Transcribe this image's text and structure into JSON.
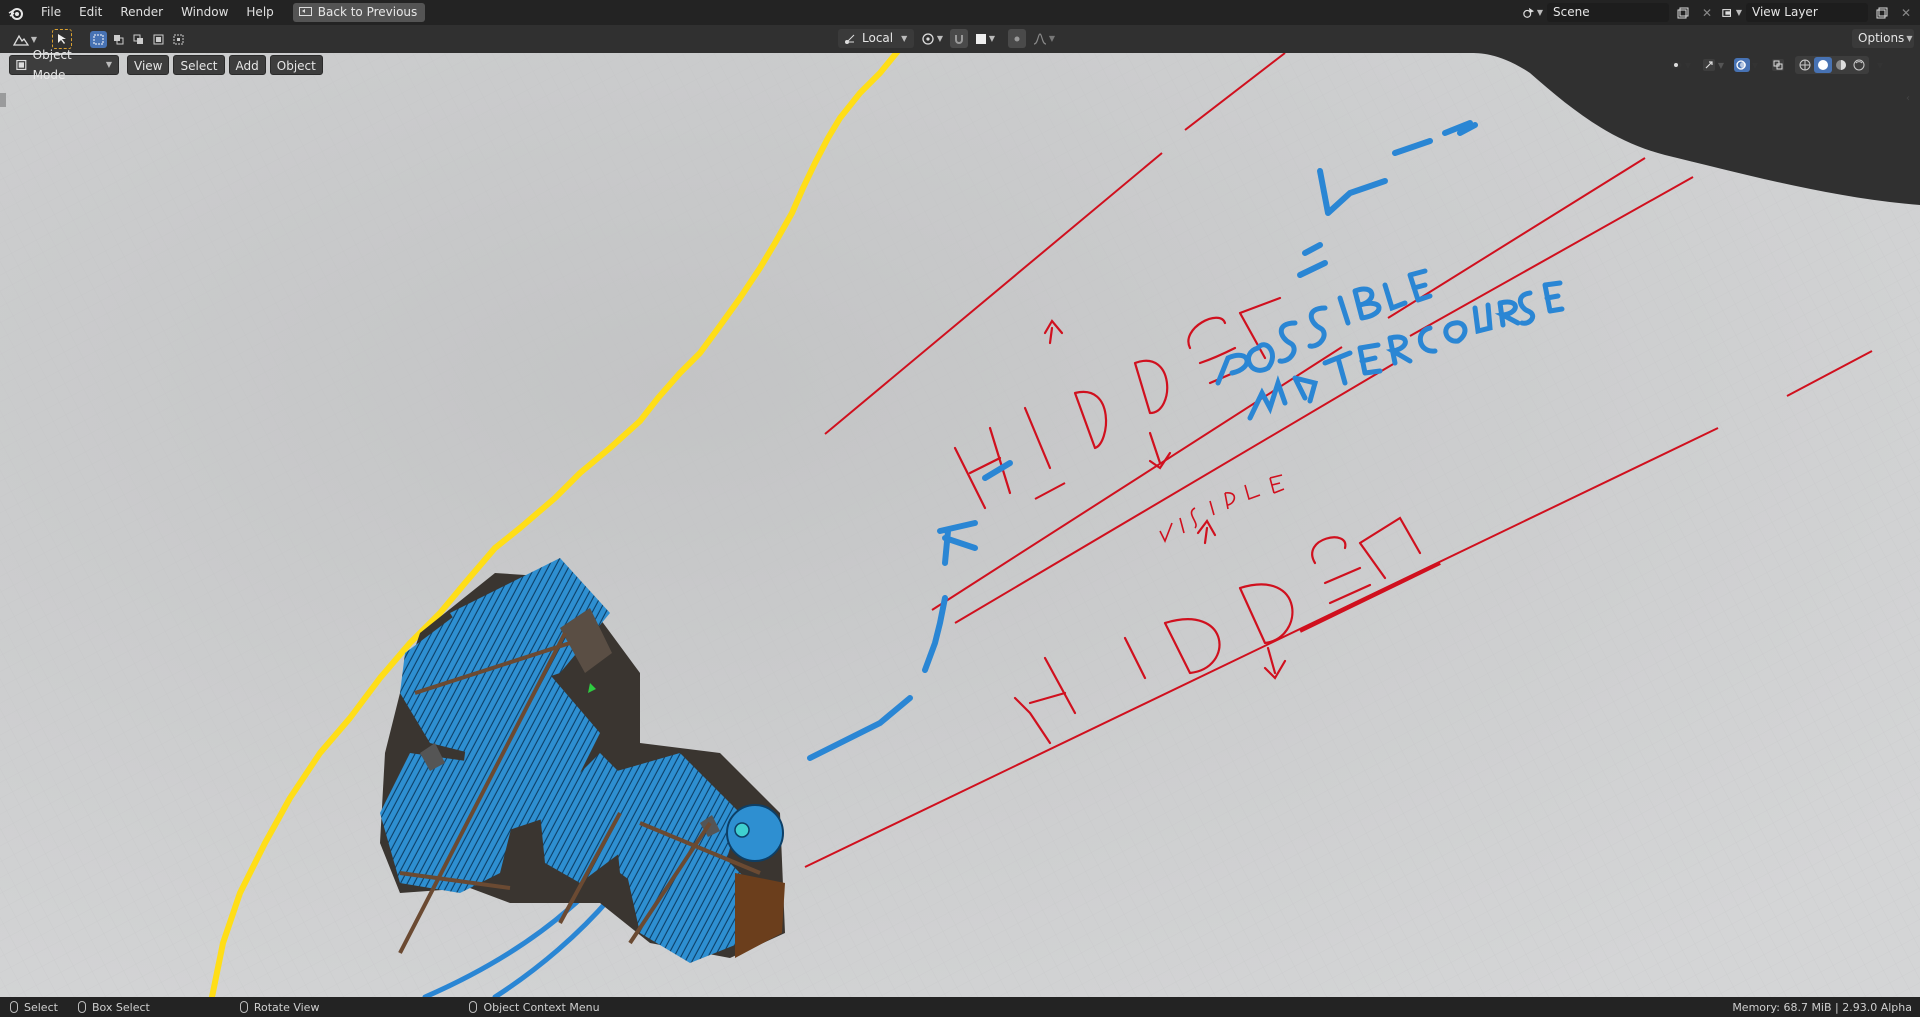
{
  "topbar": {
    "menu": [
      "File",
      "Edit",
      "Render",
      "Window",
      "Help"
    ],
    "back_button": "Back to Previous",
    "scene_name": "Scene",
    "view_layer_name": "View Layer"
  },
  "toolheader": {
    "transform_orientation": "Local",
    "options_label": "Options"
  },
  "viewport_header": {
    "mode": "Object Mode",
    "menus": [
      "View",
      "Select",
      "Add",
      "Object"
    ]
  },
  "annotations": {
    "hidden_top": "HIDDEN",
    "possible_watercourse_1": "POSSIBLE",
    "possible_watercourse_2": "WATERCOURSE",
    "visible": "VISIBLE",
    "hidden_bottom": "HIDDEN"
  },
  "statusbar": {
    "select": "Select",
    "box_select": "Box Select",
    "rotate_view": "Rotate View",
    "context_menu": "Object Context Menu",
    "memory": "Memory: 68.7 MiB | 2.93.0 Alpha"
  },
  "colors": {
    "annotation_red": "#d0101e",
    "annotation_blue": "#2a86d4",
    "yellow_line": "#ffde17",
    "building_blue": "#2e8fd1",
    "terrain": "#cfd0d1",
    "ui_dark": "#232323",
    "accent": "#4772b3"
  }
}
